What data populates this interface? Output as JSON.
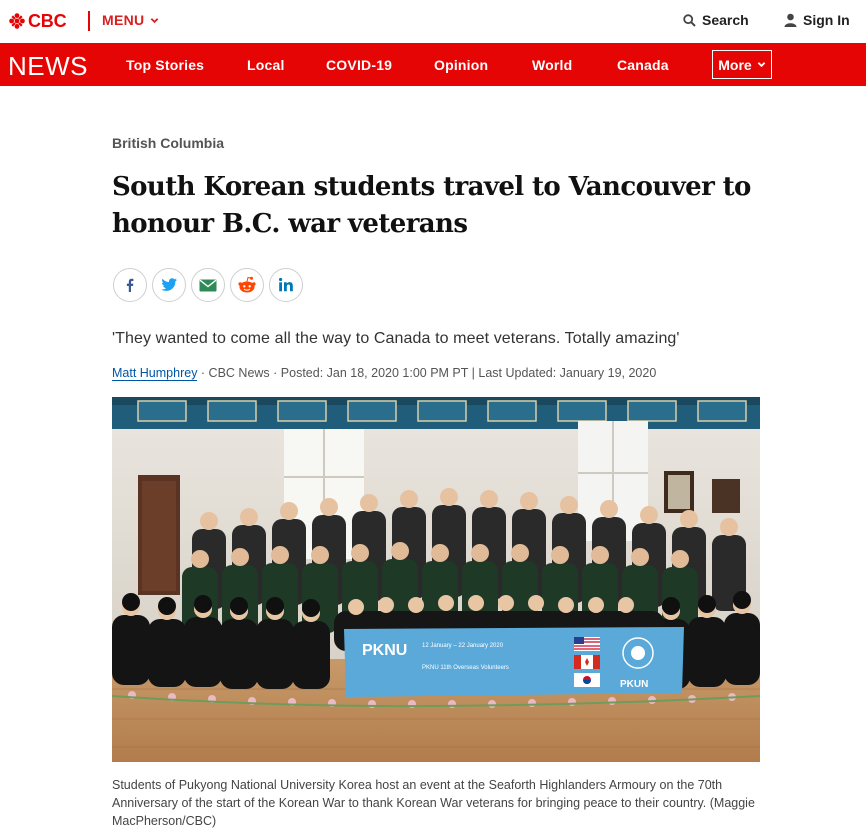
{
  "brand": {
    "logo_text": "CBC",
    "accent": "#e60505"
  },
  "topbar": {
    "menu_label": "MENU",
    "search_label": "Search",
    "signin_label": "Sign In"
  },
  "newsbar": {
    "section_label": "NEWS",
    "items": [
      {
        "label": "Top Stories"
      },
      {
        "label": "Local"
      },
      {
        "label": "COVID-19"
      },
      {
        "label": "Opinion"
      },
      {
        "label": "World"
      },
      {
        "label": "Canada"
      }
    ],
    "more_label": "More"
  },
  "article": {
    "category": "British Columbia",
    "headline": "South Korean students travel to Vancouver to honour B.C. war veterans",
    "share": [
      {
        "icon": "facebook-icon"
      },
      {
        "icon": "twitter-icon"
      },
      {
        "icon": "email-icon"
      },
      {
        "icon": "reddit-icon"
      },
      {
        "icon": "linkedin-icon"
      }
    ],
    "deck": "'They wanted to come all the way to Canada to meet veterans. Totally amazing'",
    "byline": {
      "author": "Matt Humphrey",
      "rest": " · CBC News · Posted: Jan 18, 2020 1:00 PM PT | Last Updated: January 19, 2020"
    },
    "photo": {
      "banner_title": "PKNU",
      "banner_dates": "12 January – 22 January 2020",
      "banner_sub": "PKNU 11th Overseas Volunteers",
      "banner_org": "PKUN"
    },
    "caption": "Students of Pukyong National University Korea host an event at the Seaforth Highlanders Armoury on the 70th Anniversary of the start of the Korean War to thank Korean War veterans for bringing peace to their country. (Maggie MacPherson/CBC)"
  }
}
